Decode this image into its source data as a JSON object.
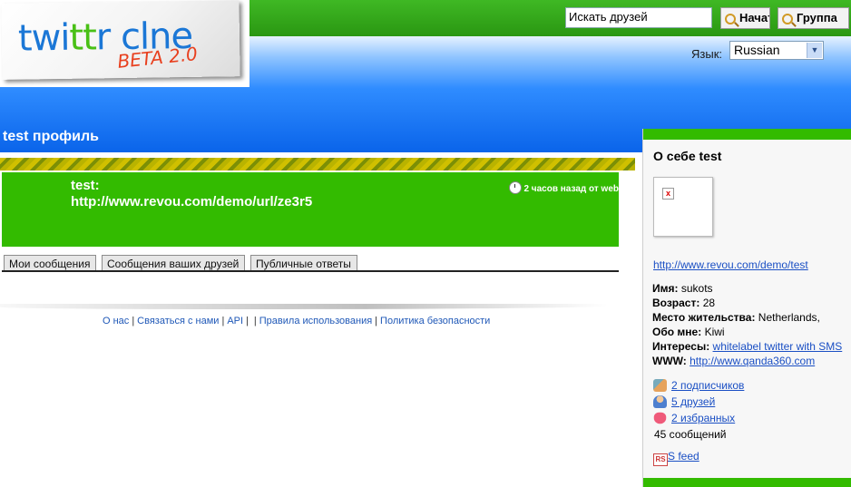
{
  "header": {
    "logo_text_blue1": "twi",
    "logo_text_green": "tt",
    "logo_text_blue2": "r clne",
    "logo_beta": "BETA 2.0",
    "search_placeholder": "Искать друзей",
    "search_button_label": "Начать",
    "group_button_label": "Группа",
    "language_label": "Язык:",
    "language_selected": "Russian"
  },
  "page_title": "test профиль",
  "tweet": {
    "author": "test:",
    "text": "http://www.revou.com/demo/url/ze3r5",
    "meta": "2 часов назад от web"
  },
  "tabs": [
    {
      "label": "Мои сообщения"
    },
    {
      "label": "Сообщения ваших друзей"
    },
    {
      "label": "Публичные ответы"
    }
  ],
  "footer": {
    "links": [
      "О нас",
      "Связаться с нами",
      "API",
      "Правила использования",
      "Политика безопасности"
    ]
  },
  "sidebar": {
    "title": "О себе test",
    "profile_link": "http://www.revou.com/demo/test",
    "name_label": "Имя:",
    "name_value": "sukots",
    "age_label": "Возраст:",
    "age_value": "28",
    "location_label": "Место жительства:",
    "location_value": "Netherlands,",
    "about_label": "Обо мне:",
    "about_value": "Kiwi",
    "interests_label": "Интересы:",
    "interests_value": "whitelabel twitter with SMS",
    "www_label": "WWW:",
    "www_value": "http://www.qanda360.com",
    "followers": "2 подписчиков",
    "friends": "5 друзей",
    "favorites": "2 избранных",
    "messages": "45 сообщений",
    "rss_icon_text": "RS",
    "rss_label": "S feed",
    "icons": [
      "followers-icon",
      "friends-icon",
      "favorites-heart-icon",
      "rss-icon"
    ]
  },
  "colors": {
    "green": "#33bb00",
    "blue_header": "#0a64ea",
    "link": "#1a4fc4"
  }
}
